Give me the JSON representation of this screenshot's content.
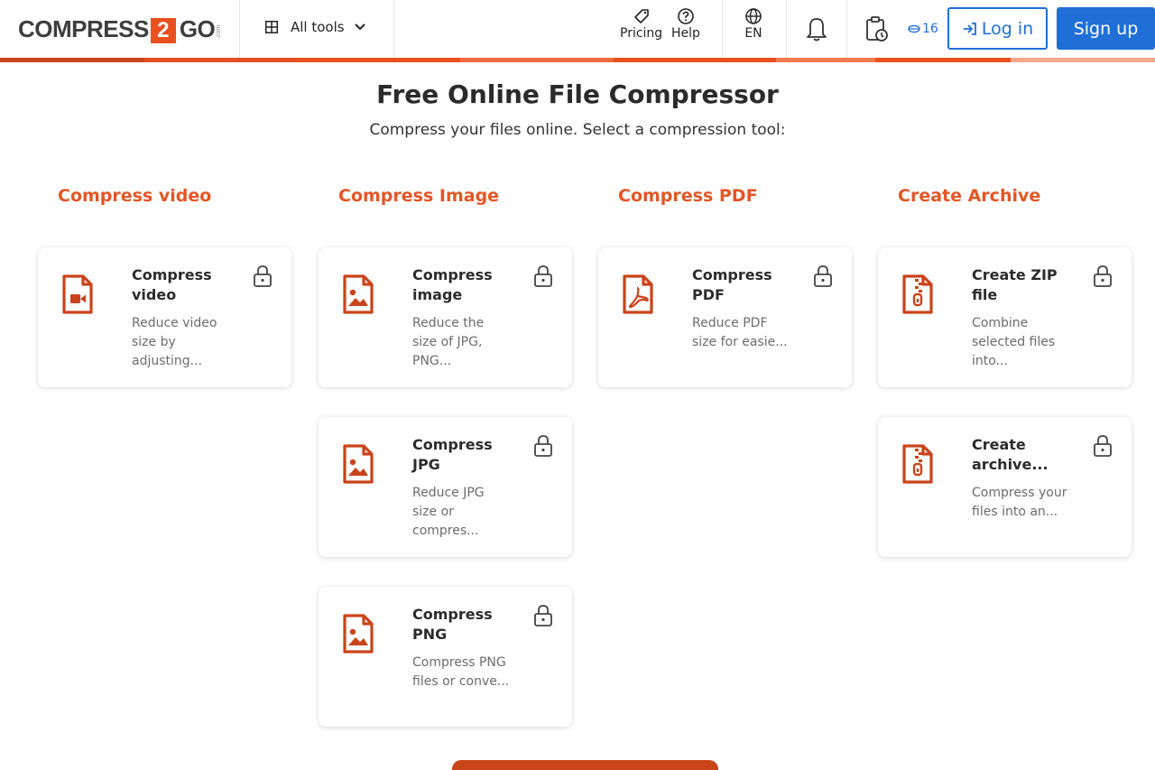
{
  "header": {
    "logo": {
      "left": "COMPRESS",
      "digit": "2",
      "right": "GO",
      "suffix": ".com"
    },
    "all_tools": "All tools",
    "pricing": "Pricing",
    "help": "Help",
    "language": "EN",
    "credits": "16",
    "login": "Log in",
    "signup": "Sign up"
  },
  "hero": {
    "title": "Free Online File Compressor",
    "subtitle": "Compress your files online. Select a compression tool:"
  },
  "columns": [
    {
      "title": "Compress video",
      "cards": [
        {
          "title": "Compress video",
          "desc": "Reduce video size by adjusting...",
          "icon": "video-file-icon"
        }
      ]
    },
    {
      "title": "Compress Image",
      "cards": [
        {
          "title": "Compress image",
          "desc": "Reduce the size of JPG, PNG...",
          "icon": "image-file-icon"
        },
        {
          "title": "Compress JPG",
          "desc": "Reduce JPG size or compres...",
          "icon": "image-file-icon"
        },
        {
          "title": "Compress PNG",
          "desc": "Compress PNG files or conve...",
          "icon": "image-file-icon"
        }
      ]
    },
    {
      "title": "Compress PDF",
      "cards": [
        {
          "title": "Compress PDF",
          "desc": "Reduce PDF size for easie...",
          "icon": "pdf-file-icon"
        }
      ]
    },
    {
      "title": "Create Archive",
      "cards": [
        {
          "title": "Create ZIP file",
          "desc": "Combine selected files into...",
          "icon": "zip-file-icon"
        },
        {
          "title": "Create archive...",
          "desc": "Compress your files into an...",
          "icon": "zip-file-icon"
        }
      ]
    }
  ],
  "colors": {
    "accent": "#e35626",
    "icon": "#c9441a",
    "primary_blue": "#1f6fd6",
    "accent_bar": [
      "#c9441a",
      "#e8501f",
      "#f07a4f",
      "#f5a789"
    ]
  }
}
